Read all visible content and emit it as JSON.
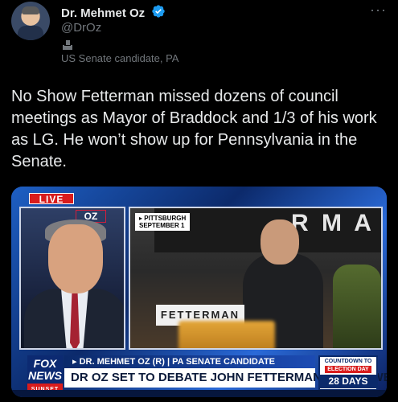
{
  "tweet": {
    "author_name": "Dr. Mehmet Oz",
    "handle": "@DrOz",
    "label": "US Senate candidate, PA",
    "more_label": "···",
    "text": "No Show Fetterman missed dozens of council meetings as Mayor of Braddock and 1/3 of his work as LG. He won’t show up for Pennsylvania in the Senate."
  },
  "media": {
    "live": "LIVE",
    "oz_logo": "OZ",
    "pittsburgh_tag_line1": "▸ PITTSBURGH",
    "pittsburgh_tag_line2": "SEPTEMBER 1",
    "stage_banner": "R M A",
    "sign_text": "FETTERMAN",
    "fox_logo": "FOX",
    "fox_logo_2": "NEWS",
    "fox_sub": "SUNSET",
    "subtitle": "▸ DR. MEHMET OZ (R) | PA SENATE CANDIDATE",
    "headline": "DR OZ SET TO DEBATE JOHN FETTERMAN IN TWO WEEKS",
    "countdown_title": "COUNTDOWN TO",
    "countdown_sub": "ELECTION DAY",
    "countdown_days": "28 DAYS"
  },
  "colors": {
    "background": "#000000",
    "text": "#e7e9ea",
    "muted": "#71767b",
    "verified": "#1d9bf0",
    "fox_blue": "#0b2a6b",
    "live_red": "#d91c1c"
  }
}
